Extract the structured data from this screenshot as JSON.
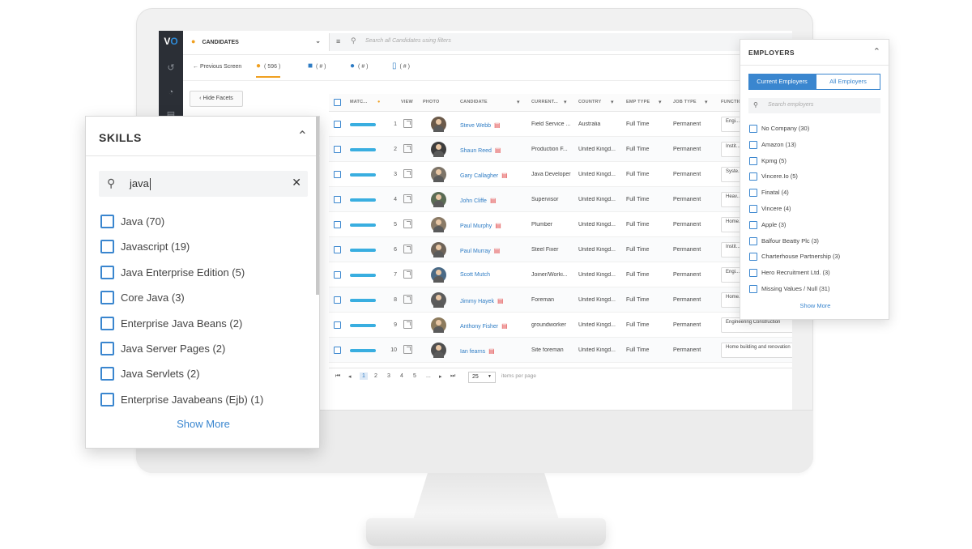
{
  "app": {
    "logo_v": "V",
    "logo_o": "O"
  },
  "topbar": {
    "entity": "CANDIDATES",
    "search_placeholder": "Search all Candidates using filters"
  },
  "tabs": {
    "previous": "Previous Screen",
    "items": [
      {
        "label": "( 596 )",
        "icon": "person-icon",
        "active": true
      },
      {
        "label": "( # )",
        "icon": "briefcase-icon"
      },
      {
        "label": "( # )",
        "icon": "contact-icon"
      },
      {
        "label": "( # )",
        "icon": "document-icon"
      }
    ]
  },
  "facets": {
    "hide_label": "Hide Facets"
  },
  "grid": {
    "columns": [
      "MATC...",
      "VIEW",
      "PHOTO",
      "CANDIDATE",
      "CURRENT...",
      "COUNTRY",
      "EMP TYPE",
      "JOB TYPE",
      "FUNCTIO..."
    ],
    "rows": [
      {
        "num": "1",
        "name": "Steve Webb",
        "pdf": true,
        "current": "Field Service ...",
        "country": "Australia",
        "emp": "Full Time",
        "job": "Permanent",
        "func": "Engi..."
      },
      {
        "num": "2",
        "name": "Shaun Reed",
        "pdf": true,
        "current": "Production F...",
        "country": "United Kingd...",
        "emp": "Full Time",
        "job": "Permanent",
        "func": "Instit... comm..."
      },
      {
        "num": "3",
        "name": "Gary Callagher",
        "pdf": true,
        "current": "Java Developer",
        "country": "United Kingd...",
        "emp": "Full Time",
        "job": "Permanent",
        "func": "Syste..."
      },
      {
        "num": "4",
        "name": "John Cliffe",
        "pdf": true,
        "current": "Supervisor",
        "country": "United Kingd...",
        "emp": "Full Time",
        "job": "Permanent",
        "func": "Heav..."
      },
      {
        "num": "5",
        "name": "Paul Murphy",
        "pdf": true,
        "current": "Plumber",
        "country": "United Kingd...",
        "emp": "Full Time",
        "job": "Permanent",
        "func": "Home... reno..."
      },
      {
        "num": "6",
        "name": "Paul Murray",
        "pdf": true,
        "current": "Steel Fixer",
        "country": "United Kingd...",
        "emp": "Full Time",
        "job": "Permanent",
        "func": "Instit... comm..."
      },
      {
        "num": "7",
        "name": "Scott Mutch",
        "pdf": false,
        "current": "Joiner/Worki...",
        "country": "United Kingd...",
        "emp": "Full Time",
        "job": "Permanent",
        "func": "Engi..."
      },
      {
        "num": "8",
        "name": "Jimmy Hayek",
        "pdf": true,
        "current": "Foreman",
        "country": "United Kingd...",
        "emp": "Full Time",
        "job": "Permanent",
        "func": "Home... reno..."
      },
      {
        "num": "9",
        "name": "Anthony Fisher",
        "pdf": true,
        "current": "groundworker",
        "country": "United Kingd...",
        "emp": "Full Time",
        "job": "Permanent",
        "func": "Engineering Construction"
      },
      {
        "num": "10",
        "name": "Ian fearns",
        "pdf": true,
        "current": "Site foreman",
        "country": "United Kingd...",
        "emp": "Full Time",
        "job": "Permanent",
        "func": "Home building and renovation"
      }
    ]
  },
  "pager": {
    "pages": [
      "1",
      "2",
      "3",
      "4",
      "5",
      "..."
    ],
    "per_page": "25",
    "per_page_label": "items per page"
  },
  "skills": {
    "title": "SKILLS",
    "search_value": "java",
    "items": [
      "Java (70)",
      "Javascript (19)",
      "Java Enterprise Edition (5)",
      "Core Java (3)",
      "Enterprise Java Beans (2)",
      "Java Server Pages (2)",
      "Java Servlets (2)",
      "Enterprise Javabeans (Ejb) (1)"
    ],
    "show_more": "Show More"
  },
  "employers": {
    "title": "EMPLOYERS",
    "toggle_current": "Current Employers",
    "toggle_all": "All Employers",
    "search_placeholder": "Search employers",
    "items": [
      "No Company (30)",
      "Amazon (13)",
      "Kpmg (5)",
      "Vincere.Io (5)",
      "Finatal (4)",
      "Vincere (4)",
      "Apple (3)",
      "Balfour Beatty Plc (3)",
      "Charterhouse Partnership (3)",
      "Hero Recruitment Ltd. (3)",
      "Missing Values / Null (31)"
    ],
    "show_more": "Show More"
  },
  "colors": {
    "accent": "#3a86cf",
    "match": "#39aee0",
    "active_tab": "#f0a020",
    "rail": "#2b2f36"
  }
}
